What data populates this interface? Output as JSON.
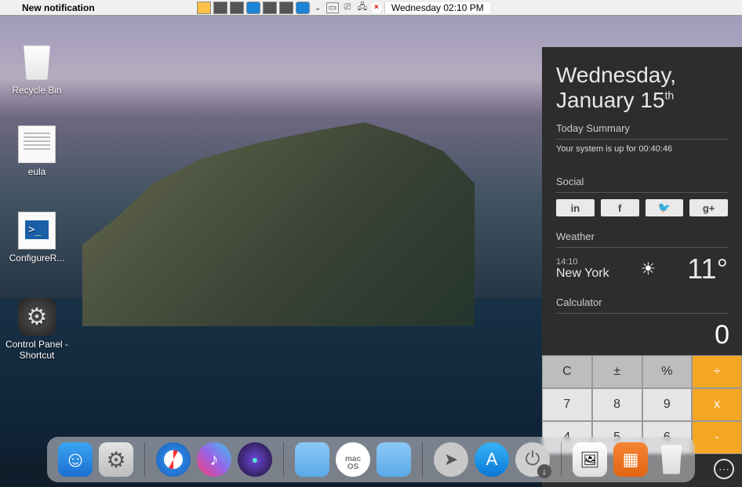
{
  "menubar": {
    "title": "New notification",
    "datetime": "Wednesday 02:10 PM"
  },
  "desktop_icons": {
    "recycle": "Recycle Bin",
    "eula": "eula",
    "config": "ConfigureR...",
    "controlpanel": "Control Panel - Shortcut"
  },
  "sidebar": {
    "date_main": "Wednesday, January 15",
    "date_suffix": "th",
    "today_summary_title": "Today Summary",
    "uptime_prefix": "Your system is up for ",
    "uptime_value": "00:40:46",
    "social_title": "Social",
    "social": {
      "linkedin": "in",
      "facebook": "f",
      "twitter": "🐦",
      "gplus": "g+"
    },
    "weather_title": "Weather",
    "weather": {
      "time": "14:10",
      "city": "New York",
      "temp": "11°"
    },
    "calculator_title": "Calculator",
    "calc_display": "0",
    "calc_row1": {
      "c": "C",
      "pm": "±",
      "pct": "%",
      "div": "÷"
    },
    "calc_row2": {
      "n7": "7",
      "n8": "8",
      "n9": "9",
      "mul": "x"
    },
    "calc_row3": {
      "n4": "4",
      "n5": "5",
      "n6": "6",
      "sub": "-"
    }
  },
  "dock": {
    "macos_label": "mac\nOS"
  }
}
